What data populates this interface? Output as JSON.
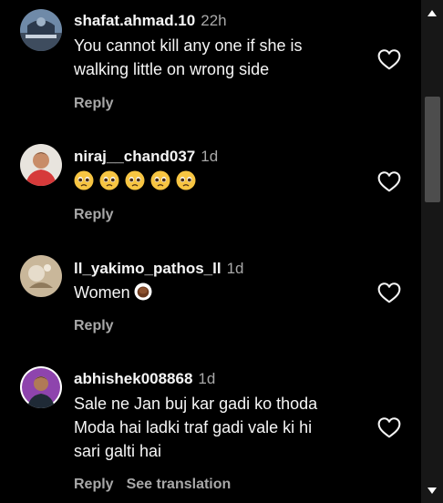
{
  "comments": [
    {
      "username": "shafat.ahmad.10",
      "time": "22h",
      "text_lines": [
        "You cannot kill any one if she is",
        "walking little on wrong side"
      ],
      "reply_label": "Reply"
    },
    {
      "username": "niraj__chand037",
      "time": "1d",
      "emoji": [
        "pleading-face",
        "pleading-face",
        "pleading-face",
        "pleading-face",
        "pleading-face"
      ],
      "reply_label": "Reply"
    },
    {
      "username": "ll_yakimo_pathos_ll",
      "time": "1d",
      "text": "Women",
      "text_emoji": "hot-beverage",
      "reply_label": "Reply"
    },
    {
      "username": "abhishek008868",
      "time": "1d",
      "text_lines": [
        "Sale ne Jan buj kar gadi ko thoda",
        "Moda hai ladki traf gadi vale ki hi",
        "sari galti hai"
      ],
      "reply_label": "Reply",
      "translation_label": "See translation"
    }
  ],
  "icons": {
    "like": "heart-outline-icon",
    "scroll_up": "triangle-up-icon",
    "scroll_down": "triangle-down-icon"
  },
  "colors": {
    "background": "#000000",
    "primary_text": "#f5f5f5",
    "secondary_text": "#a8a8a8",
    "scrollbar_track": "#171717",
    "scrollbar_thumb": "#4d4d4d"
  }
}
